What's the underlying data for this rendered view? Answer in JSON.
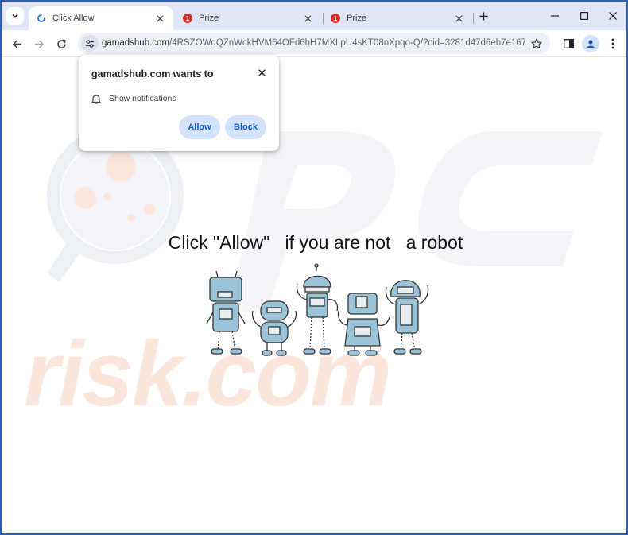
{
  "tabs": [
    {
      "label": "Click Allow",
      "active": true,
      "icon": "loading-icon"
    },
    {
      "label": "Prize",
      "active": false,
      "icon": "notification-badge",
      "badge": "1"
    },
    {
      "label": "Prize",
      "active": false,
      "icon": "notification-badge",
      "badge": "1"
    }
  ],
  "address_bar": {
    "domain": "gamadshub.com",
    "path": "/4RSZOWqQZnWckHVM64OFd6hH7MXLpU4sKT08nXpqo-Q/?cid=3281d47d6eb7e167b208..."
  },
  "popup": {
    "title": "gamadshub.com wants to",
    "permission": "Show notifications",
    "allow_label": "Allow",
    "block_label": "Block"
  },
  "page": {
    "headline": "Click \"Allow\"   if you are not   a robot",
    "watermark": "risk.com"
  },
  "colors": {
    "frame": "#2f5fb3",
    "tabstrip": "#dfe7f6",
    "button_bg": "#d3e3fd",
    "button_text": "#0b57d0",
    "badge": "#d93025",
    "watermark": "#fbe6dc",
    "robot": "#9cc4d9"
  }
}
